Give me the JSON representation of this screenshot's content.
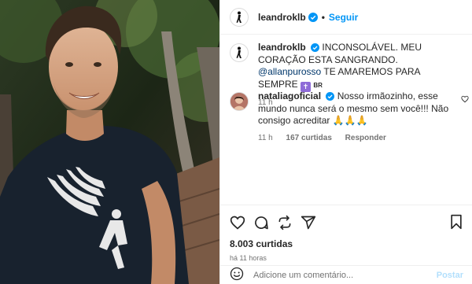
{
  "header": {
    "username": "leandroklb",
    "follow_label": "Seguir"
  },
  "caption": {
    "username": "leandroklb",
    "text": "INCONSOLÁVEL. MEU CORAÇÃO ESTA SANGRANDO.",
    "mention": "@allanpurosso",
    "text2": "TE AMAREMOS PARA SEMPRE",
    "flag": "BR",
    "time": "11 h"
  },
  "reply": {
    "username": "nataliagoficial",
    "text": "Nosso irmãozinho, esse mundo nunca será o mesmo sem você!!! Não consigo acreditar 🙏🙏🙏",
    "time": "11 h",
    "likes": "167 curtidas",
    "reply_label": "Responder"
  },
  "footer": {
    "likes": "8.003 curtidas",
    "time": "há 11 horas",
    "comment_placeholder": "Adicione um comentário...",
    "post_label": "Postar"
  },
  "colors": {
    "link_blue": "#0095f6",
    "verified_blue": "#0095f6",
    "muted": "#737373"
  },
  "icons": [
    "verified-icon",
    "heart-icon",
    "comment-icon",
    "share-icon",
    "send-icon",
    "bookmark-icon",
    "emoji-icon"
  ]
}
